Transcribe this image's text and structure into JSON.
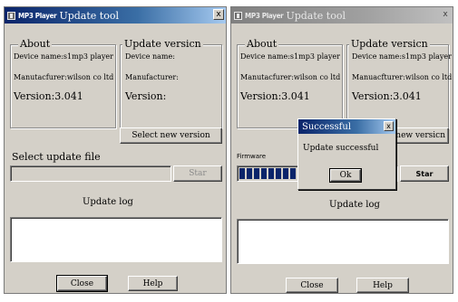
{
  "left_window": {
    "title_brand": "MP3 Player",
    "title": "Update tool",
    "close_glyph": "x",
    "about": {
      "legend": "About",
      "device": "Device name:s1mp3 player",
      "manufacturer": "Manutacfurer:wilson co ltd",
      "version": "Version:3.041"
    },
    "update": {
      "legend": "Update versicn",
      "device": "Device name:",
      "manufacturer": "Manufacturer:",
      "version": "Version:"
    },
    "select_new_version_label": "Select new version",
    "select_file_label": "Select update file",
    "start_label": "Star",
    "update_log_label": "Update log",
    "close_label": "Close",
    "help_label": "Help"
  },
  "right_window": {
    "title_brand": "MP3 Player",
    "title": "Update tool",
    "close_glyph": "x",
    "about": {
      "legend": "About",
      "device": "Device name:s1mp3 player",
      "manufacturer": "Manutacfurer:wilson co ltd",
      "version": "Version:3.041"
    },
    "update": {
      "legend": "Update versicn",
      "device": "Device name:s1mp3 player",
      "manufacturer": "Manuacfturer:wilson co ltd",
      "version": "Version:3.041"
    },
    "select_new_version_label": "ect new versicn",
    "progress_label": "Firmware",
    "progress_fraction": 0.82,
    "start_label": "Star",
    "update_log_label": "Update log",
    "close_label": "Close",
    "help_label": "Help",
    "dialog": {
      "title": "Successful",
      "close_glyph": "x",
      "message": "Update successful",
      "ok_label": "Ok"
    }
  },
  "colors": {
    "window_face": "#d4d0c8",
    "title_active": "#0a246a",
    "title_inactive": "#808080",
    "progress": "#0a246a"
  }
}
